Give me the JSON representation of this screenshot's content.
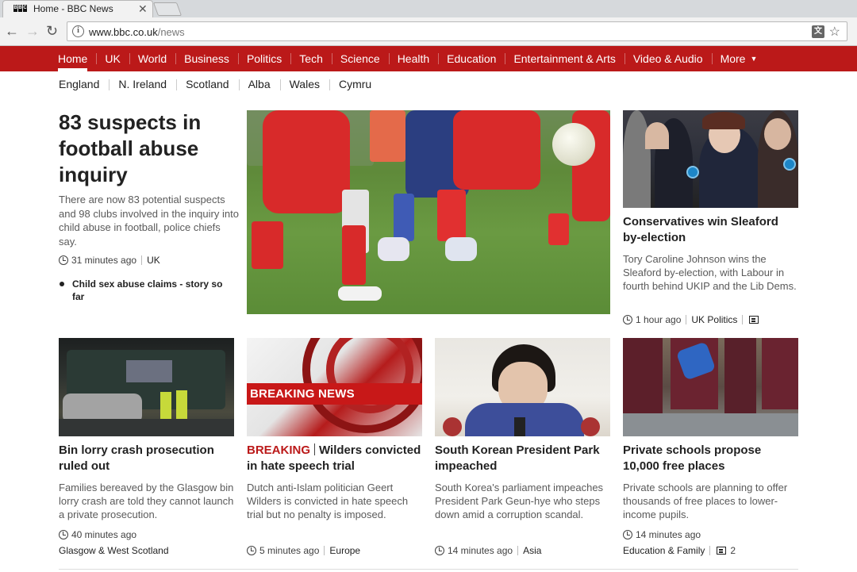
{
  "browser": {
    "tab_title": "Home - BBC News",
    "tab_close": "✕",
    "url_host": "www.bbc.co.uk",
    "url_path": "/news",
    "info_glyph": "i",
    "translate_glyph": "文",
    "star_glyph": "☆",
    "back_glyph": "←",
    "forward_glyph": "→",
    "reload_glyph": "↻"
  },
  "nav": {
    "items": [
      {
        "label": "Home"
      },
      {
        "label": "UK"
      },
      {
        "label": "World"
      },
      {
        "label": "Business"
      },
      {
        "label": "Politics"
      },
      {
        "label": "Tech"
      },
      {
        "label": "Science"
      },
      {
        "label": "Health"
      },
      {
        "label": "Education"
      },
      {
        "label": "Entertainment & Arts"
      },
      {
        "label": "Video & Audio"
      },
      {
        "label": "More"
      }
    ],
    "more_caret": "▼"
  },
  "subnav": {
    "items": [
      "England",
      "N. Ireland",
      "Scotland",
      "Alba",
      "Wales",
      "Cymru"
    ]
  },
  "lead": {
    "headline": "83 suspects in football abuse inquiry",
    "summary": "There are now 83 potential suspects and 98 clubs involved in the inquiry into child abuse in football, police chiefs say.",
    "time": "31 minutes ago",
    "section": "UK",
    "related": "Child sex abuse claims - story so far"
  },
  "sleaford": {
    "headline": "Conservatives win Sleaford by-election",
    "summary": "Tory Caroline Johnson wins the Sleaford by-election, with Labour in fourth behind UKIP and the Lib Dems.",
    "time": "1 hour ago",
    "section": "UK Politics"
  },
  "stories": [
    {
      "headline": "Bin lorry crash prosecution ruled out",
      "summary": "Families bereaved by the Glasgow bin lorry crash are told they cannot launch a private prosecution.",
      "time": "40 minutes ago",
      "section": "Glasgow & West Scotland"
    },
    {
      "tag": "BREAKING",
      "headline": "Wilders convicted in hate speech trial",
      "summary": "Dutch anti-Islam politician Geert Wilders is convicted in hate speech trial but no penalty is imposed.",
      "time": "5 minutes ago",
      "section": "Europe",
      "image_text": "BREAKING NEWS"
    },
    {
      "headline": "South Korean President Park impeached",
      "summary": "South Korea's parliament impeaches President Park Geun-hye who steps down amid a corruption scandal.",
      "time": "14 minutes ago",
      "section": "Asia"
    },
    {
      "headline": "Private schools propose 10,000 free places",
      "summary": "Private schools are planning to offer thousands of free places to lower-income pupils.",
      "time": "14 minutes ago",
      "section": "Education & Family",
      "comments": "2"
    }
  ],
  "colors": {
    "bbc_red": "#bb1919",
    "breaking_red": "#bb1919"
  }
}
